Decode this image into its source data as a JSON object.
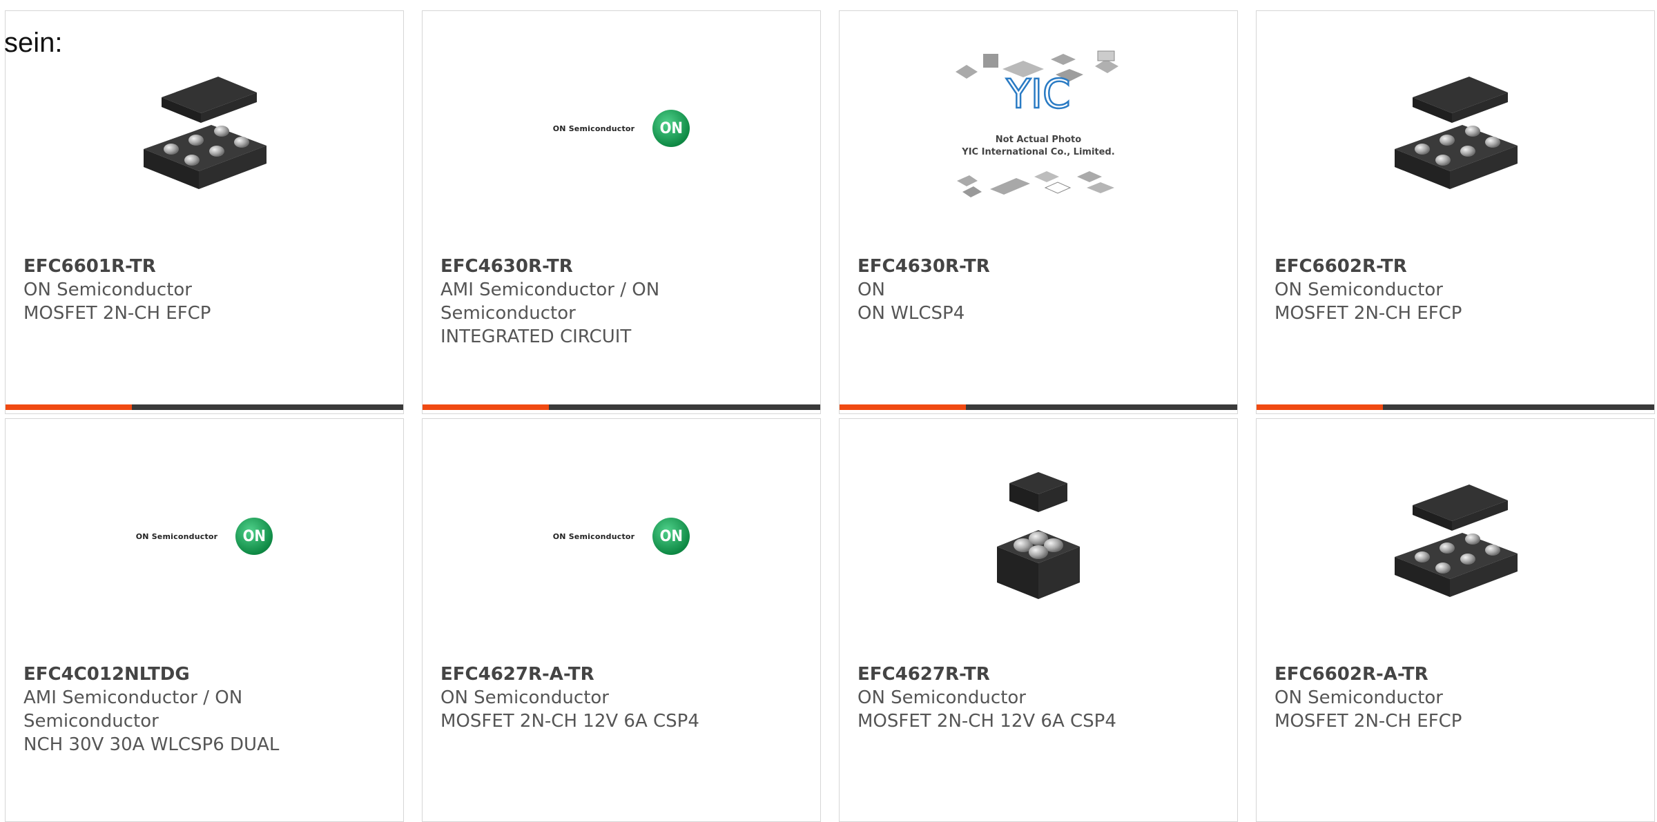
{
  "intro_text": "sein:",
  "accent_color": "#f04a12",
  "bar_color": "#3a3a3a",
  "products": [
    {
      "part_number": "EFC6601R-TR",
      "manufacturer": "ON Semiconductor",
      "manufacturer_line2": "",
      "description": "MOSFET 2N-CH EFCP",
      "image": "chip-6ball-photo"
    },
    {
      "part_number": "EFC4630R-TR",
      "manufacturer": "AMI Semiconductor / ON",
      "manufacturer_line2": "Semiconductor",
      "description": "INTEGRATED CIRCUIT",
      "image": "on-semiconductor-logo",
      "logo_text": "ON Semiconductor",
      "logo_mark": "ON"
    },
    {
      "part_number": "EFC4630R-TR",
      "manufacturer": "ON",
      "manufacturer_line2": "",
      "description": "ON WLCSP4",
      "image": "yic-not-actual-photo",
      "yic_logo": "YIC",
      "yic_caption1": "Not Actual Photo",
      "yic_caption2": "YIC International Co., Limited."
    },
    {
      "part_number": "EFC6602R-TR",
      "manufacturer": "ON Semiconductor",
      "manufacturer_line2": "",
      "description": "MOSFET 2N-CH EFCP",
      "image": "chip-6ball-photo"
    },
    {
      "part_number": "EFC4C012NLTDG",
      "manufacturer": "AMI Semiconductor / ON",
      "manufacturer_line2": "Semiconductor",
      "description": "NCH 30V 30A WLCSP6 DUAL",
      "image": "on-semiconductor-logo",
      "logo_text": "ON Semiconductor",
      "logo_mark": "ON"
    },
    {
      "part_number": "EFC4627R-A-TR",
      "manufacturer": "ON Semiconductor",
      "manufacturer_line2": "",
      "description": "MOSFET 2N-CH 12V 6A CSP4",
      "image": "on-semiconductor-logo",
      "logo_text": "ON Semiconductor",
      "logo_mark": "ON"
    },
    {
      "part_number": "EFC4627R-TR",
      "manufacturer": "ON Semiconductor",
      "manufacturer_line2": "",
      "description": "MOSFET 2N-CH 12V 6A CSP4",
      "image": "chip-4ball-photo"
    },
    {
      "part_number": "EFC6602R-A-TR",
      "manufacturer": "ON Semiconductor",
      "manufacturer_line2": "",
      "description": "MOSFET 2N-CH EFCP",
      "image": "chip-6ball-photo"
    }
  ]
}
